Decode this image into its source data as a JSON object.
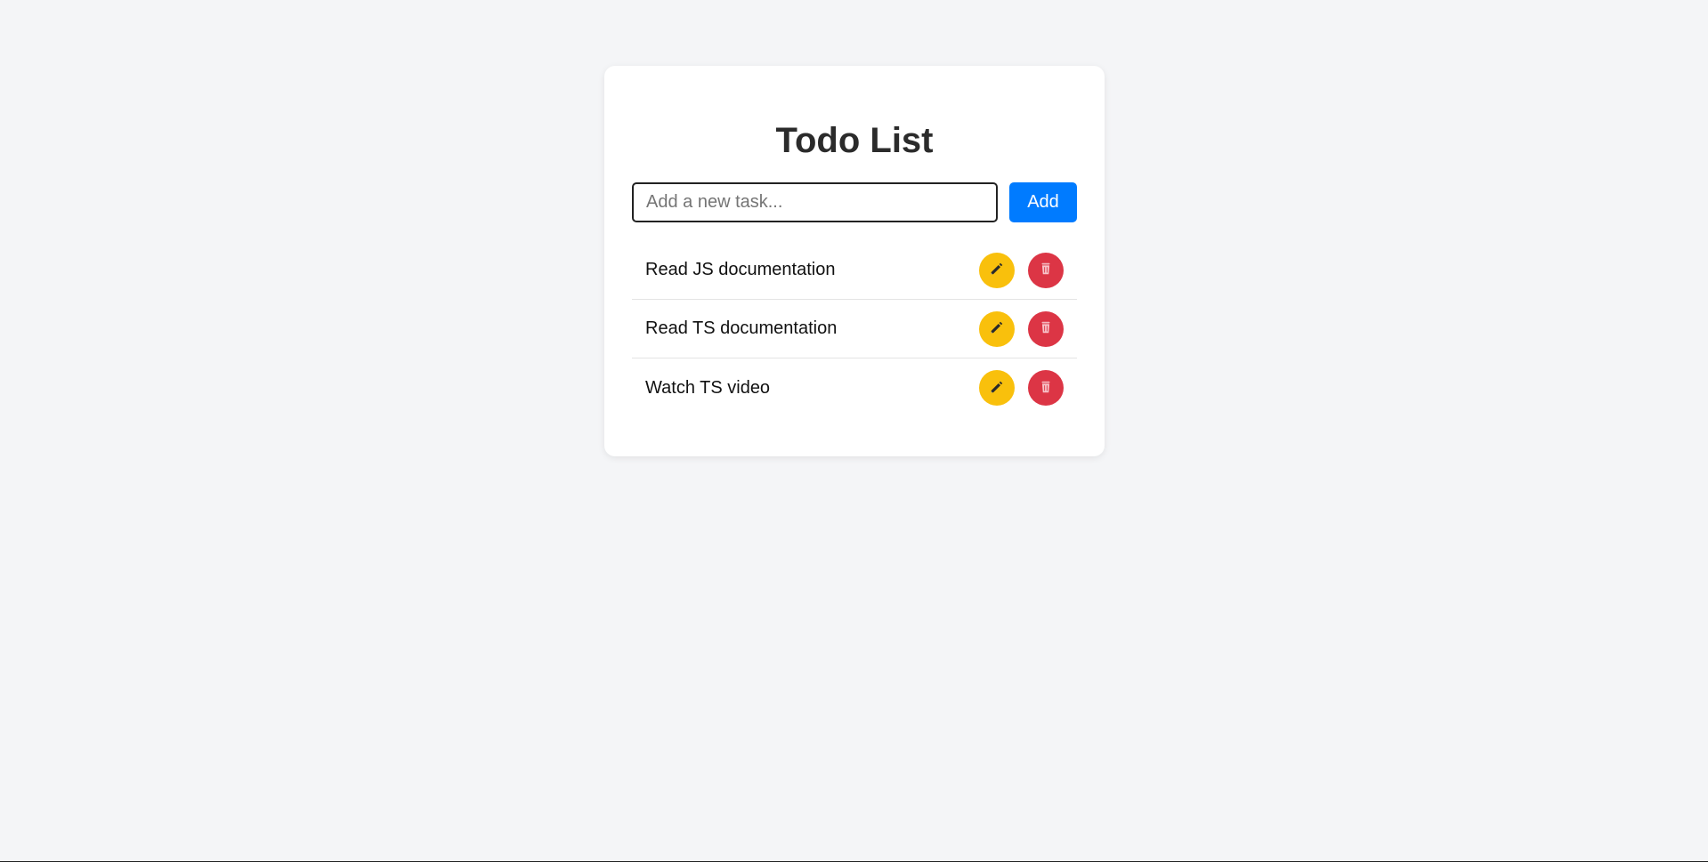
{
  "app": {
    "title": "Todo List"
  },
  "input": {
    "placeholder": "Add a new task...",
    "value": ""
  },
  "add_button": {
    "label": "Add"
  },
  "tasks": [
    {
      "text": "Read JS documentation"
    },
    {
      "text": "Read TS documentation"
    },
    {
      "text": "Watch TS video"
    }
  ],
  "icons": {
    "edit": "pencil-icon",
    "delete": "trash-icon"
  },
  "colors": {
    "page_bg": "#f4f5f7",
    "card_bg": "#ffffff",
    "add_button": "#007bff",
    "edit_button": "#f9c00c",
    "delete_button": "#dc3545"
  }
}
